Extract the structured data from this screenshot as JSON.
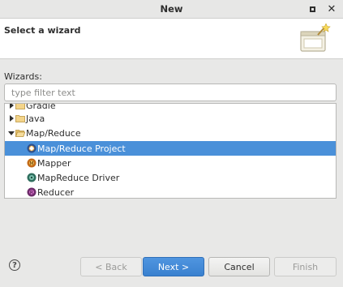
{
  "window": {
    "title": "New",
    "maximize_icon": "maximize-icon",
    "close_glyph": "✕"
  },
  "banner": {
    "title": "Select a wizard",
    "icon": "wizard-banner-icon"
  },
  "wizards_label": "Wizards:",
  "filter": {
    "placeholder": "type filter text",
    "value": ""
  },
  "tree": {
    "items": [
      {
        "label": "Gradle",
        "kind": "folder",
        "state": "collapsed",
        "icon": "folder-icon"
      },
      {
        "label": "Java",
        "kind": "folder",
        "state": "collapsed",
        "icon": "folder-icon"
      },
      {
        "label": "Map/Reduce",
        "kind": "folder",
        "state": "expanded",
        "icon": "folder-open-icon"
      },
      {
        "label": "Map/Reduce Project",
        "kind": "wizard",
        "selected": true,
        "icon": "mapreduce-project-icon"
      },
      {
        "label": "Mapper",
        "kind": "wizard",
        "icon": "mapper-icon"
      },
      {
        "label": "MapReduce Driver",
        "kind": "wizard",
        "icon": "mapreduce-driver-icon"
      },
      {
        "label": "Reducer",
        "kind": "wizard",
        "icon": "reducer-icon"
      }
    ]
  },
  "buttons": {
    "help": "?",
    "back": "< Back",
    "next": "Next >",
    "cancel": "Cancel",
    "finish": "Finish"
  },
  "colors": {
    "selection": "#4a90d9",
    "primary_button": "#3a81cf"
  }
}
